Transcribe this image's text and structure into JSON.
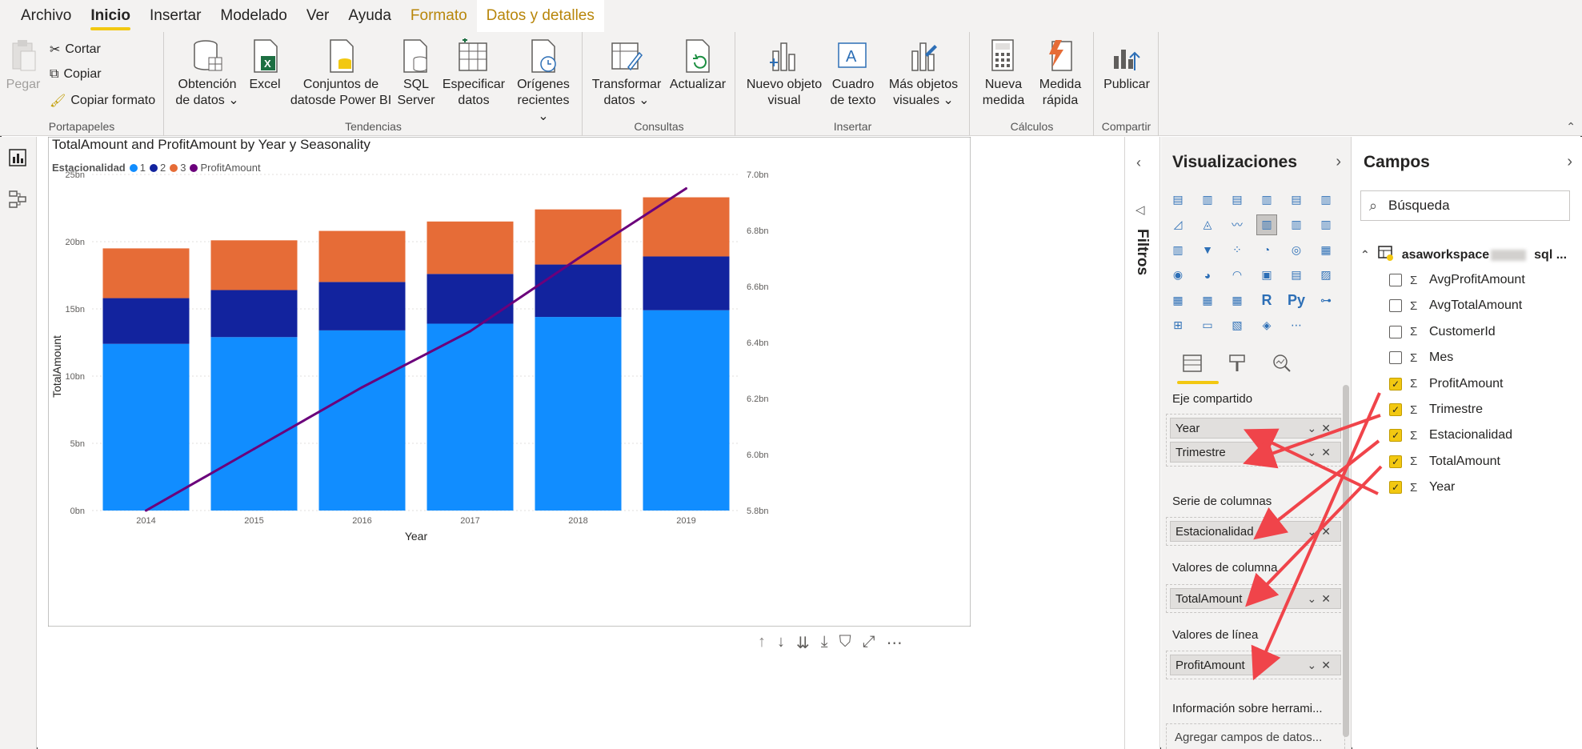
{
  "menu": {
    "items": [
      "Archivo",
      "Inicio",
      "Insertar",
      "Modelado",
      "Ver",
      "Ayuda",
      "Formato",
      "Datos y detalles"
    ],
    "active_index": 1
  },
  "ribbon": {
    "pegar": "Pegar",
    "cortar": "Cortar",
    "copiar": "Copiar",
    "copiar_formato": "Copiar formato",
    "portapapeles": "Portapapeles",
    "obtencion_1": "Obtención",
    "obtencion_2": "de datos ⌄",
    "excel": "Excel",
    "conjuntos_1": "Conjuntos de",
    "conjuntos_2": "datosde Power BI",
    "sql_1": "SQL",
    "sql_2": "Server",
    "especificar_1": "Especificar",
    "especificar_2": "datos",
    "origenes_1": "Orígenes",
    "origenes_2": "recientes ⌄",
    "tendencias": "Tendencias",
    "transformar_1": "Transformar",
    "transformar_2": "datos ⌄",
    "actualizar": "Actualizar",
    "consultas": "Consultas",
    "nuevo_1": "Nuevo objeto",
    "nuevo_2": "visual",
    "cuadro_1": "Cuadro",
    "cuadro_2": "de texto",
    "mas_1": "Más objetos",
    "mas_2": "visuales ⌄",
    "insertar": "Insertar",
    "nueva_1": "Nueva",
    "nueva_2": "medida",
    "medida_1": "Medida",
    "medida_2": "rápida",
    "calculos": "Cálculos",
    "publicar": "Publicar",
    "compartir": "Compartir"
  },
  "chart_data": {
    "type": "bar",
    "title": "TotalAmount and ProfitAmount by Year y Seasonality",
    "legend_title": "Estacionalidad",
    "legend_items": [
      "1",
      "2",
      "3",
      "ProfitAmount"
    ],
    "categories": [
      "2014",
      "2015",
      "2016",
      "2017",
      "2018",
      "2019"
    ],
    "series": [
      {
        "name": "1",
        "color": "#118dff",
        "values": [
          12.4,
          12.9,
          13.4,
          13.9,
          14.4,
          14.9
        ]
      },
      {
        "name": "2",
        "color": "#12239e",
        "values": [
          3.4,
          3.5,
          3.6,
          3.7,
          3.9,
          4.0
        ]
      },
      {
        "name": "3",
        "color": "#e66c37",
        "values": [
          3.7,
          3.7,
          3.8,
          3.9,
          4.1,
          4.4
        ]
      }
    ],
    "line": {
      "name": "ProfitAmount",
      "color": "#6b007b",
      "values": [
        5.8,
        6.02,
        6.24,
        6.44,
        6.7,
        6.95
      ]
    },
    "xlabel": "Year",
    "ylabel": "TotalAmount",
    "y_ticks": [
      "0bn",
      "5bn",
      "10bn",
      "15bn",
      "20bn",
      "25bn"
    ],
    "y2_ticks": [
      "5.8bn",
      "6.0bn",
      "6.2bn",
      "6.4bn",
      "6.6bn",
      "6.8bn",
      "7.0bn"
    ],
    "ylim": [
      0,
      25
    ],
    "y2lim": [
      5.8,
      7.0
    ],
    "grid": true,
    "legend_position": "top-left"
  },
  "filters": {
    "label": "Filtros"
  },
  "viz": {
    "title": "Visualizaciones",
    "shared_axis_label": "Eje compartido",
    "shared_axis_fields": [
      "Year",
      "Trimestre"
    ],
    "column_series_label": "Serie de columnas",
    "column_series_field": "Estacionalidad",
    "column_values_label": "Valores de columna",
    "column_values_field": "TotalAmount",
    "line_values_label": "Valores de línea",
    "line_values_field": "ProfitAmount",
    "tooltips_label": "Información sobre herrami...",
    "tooltips_placeholder": "Agregar campos de datos..."
  },
  "fields": {
    "title": "Campos",
    "search_placeholder": "Búsqueda",
    "table_name_prefix": "asaworkspace",
    "table_name_suffix": "sql ...",
    "items": [
      {
        "name": "AvgProfitAmount",
        "checked": false
      },
      {
        "name": "AvgTotalAmount",
        "checked": false
      },
      {
        "name": "CustomerId",
        "checked": false
      },
      {
        "name": "Mes",
        "checked": false
      },
      {
        "name": "ProfitAmount",
        "checked": true
      },
      {
        "name": "Trimestre",
        "checked": true
      },
      {
        "name": "Estacionalidad",
        "checked": true
      },
      {
        "name": "TotalAmount",
        "checked": true
      },
      {
        "name": "Year",
        "checked": true
      }
    ]
  },
  "colors": {
    "accent": "#f2c811",
    "arrow": "#f0444a"
  }
}
